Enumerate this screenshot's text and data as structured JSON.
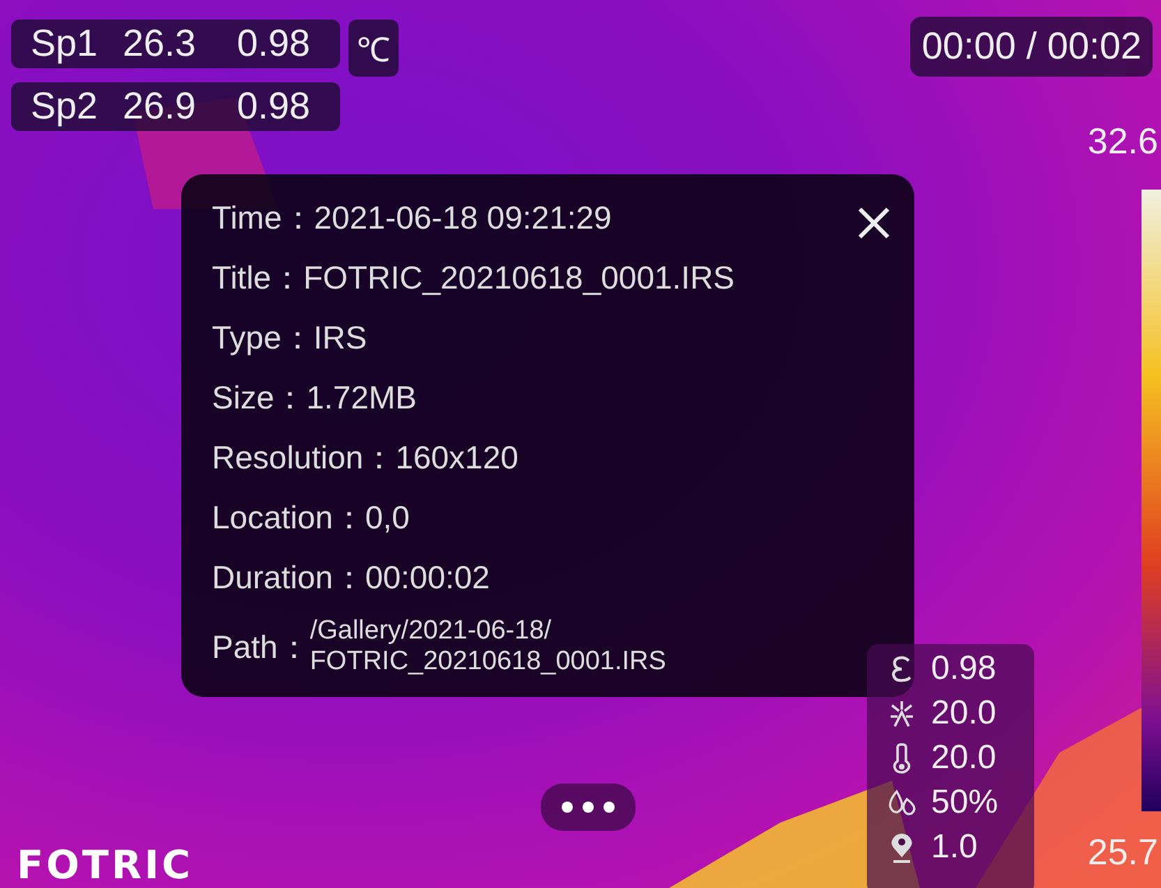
{
  "spots": [
    {
      "name": "Sp1",
      "temperature": "26.3",
      "emissivity": "0.98"
    },
    {
      "name": "Sp2",
      "temperature": "26.9",
      "emissivity": "0.98"
    }
  ],
  "unit": "℃",
  "playback_time": "00:00 / 00:02",
  "scale": {
    "max": "32.6",
    "min": "25.7"
  },
  "info_dialog": {
    "fields": [
      {
        "kind": "single",
        "label": "Time：",
        "value": "2021-06-18 09:21:29"
      },
      {
        "kind": "single",
        "label": "Title：",
        "value": "FOTRIC_20210618_0001.IRS"
      },
      {
        "kind": "single",
        "label": "Type：",
        "value": "IRS"
      },
      {
        "kind": "single",
        "label": "Size：",
        "value": "1.72MB"
      },
      {
        "kind": "single",
        "label": "Resolution：",
        "value": "160x120"
      },
      {
        "kind": "single",
        "label": "Location：",
        "value": "0,0"
      },
      {
        "kind": "single",
        "label": "Duration：",
        "value": "00:00:02"
      },
      {
        "kind": "path",
        "label": "Path：",
        "value_lines": [
          "/Gallery/2021-06-18/",
          "FOTRIC_20210618_0001.IRS"
        ]
      }
    ]
  },
  "parameters": [
    {
      "kind": "emissivity",
      "value": "0.98"
    },
    {
      "kind": "reflected",
      "value": "20.0"
    },
    {
      "kind": "ambient",
      "value": "20.0"
    },
    {
      "kind": "humidity",
      "value": "50%"
    },
    {
      "kind": "distance",
      "value": "1.0"
    }
  ],
  "logo": "FOTRIC"
}
